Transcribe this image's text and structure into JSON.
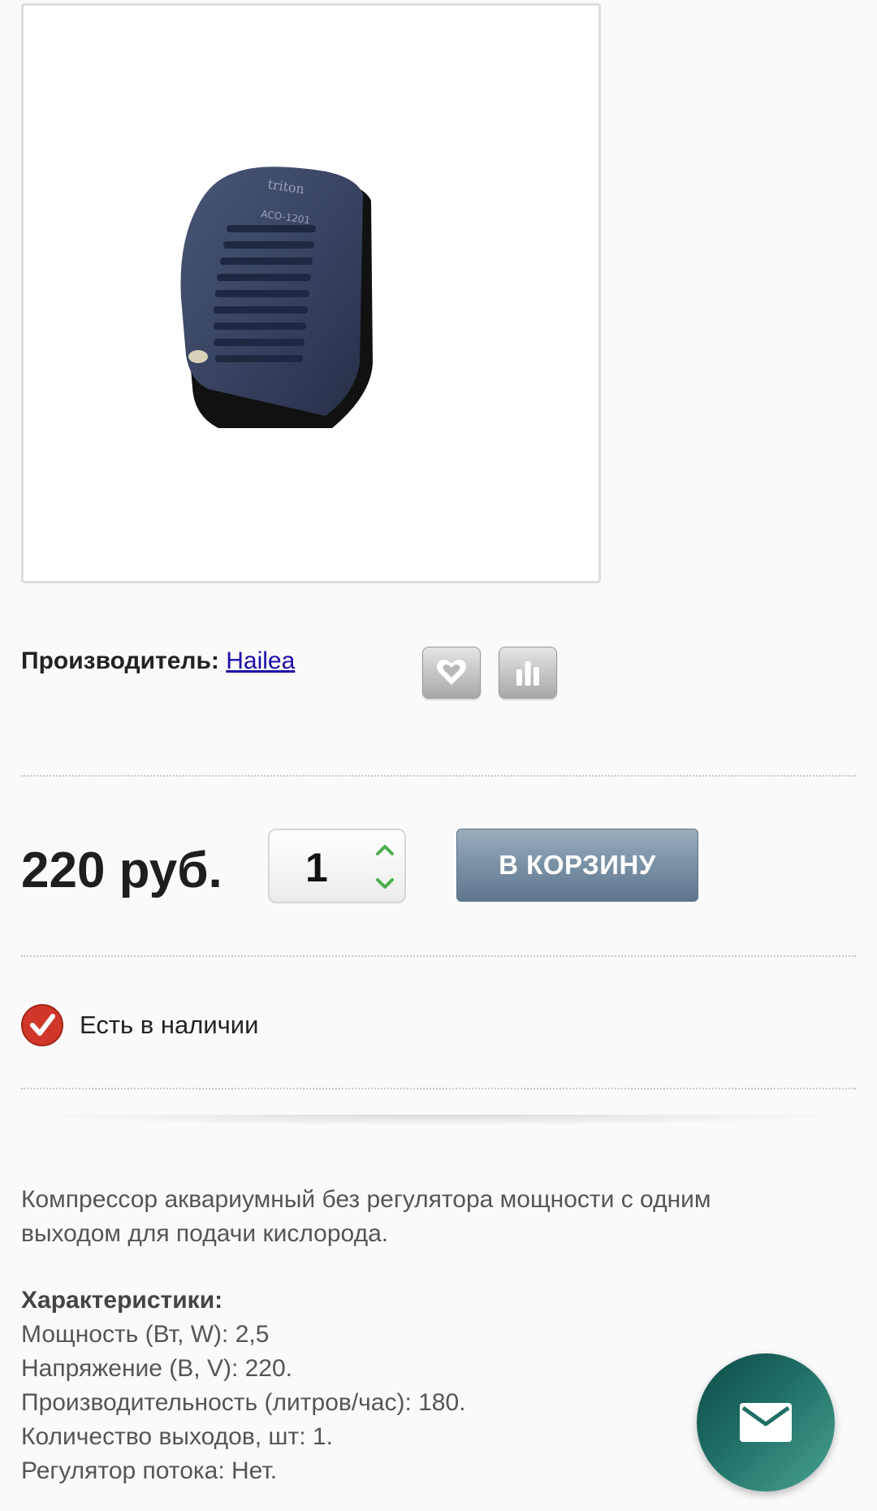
{
  "product_image": {
    "device_brand": "triton",
    "device_model": "ACO-1201"
  },
  "manufacturer": {
    "label": "Производитель:",
    "name": "Hailea"
  },
  "actions": {
    "wishlist_icon": "heart-icon",
    "compare_icon": "bar-chart-icon"
  },
  "purchase": {
    "price": "220 руб.",
    "quantity": "1",
    "add_to_cart_label": "В КОРЗИНУ"
  },
  "availability": {
    "text": "Есть в наличии",
    "icon": "check-badge-icon"
  },
  "description": {
    "line1": "Компрессор аквариумный без регулятора мощности с одним",
    "line2": "выходом для подачи кислорода."
  },
  "specs": {
    "heading": "Характеристики:",
    "items": [
      "Мощность (Вт, W): 2,5",
      "Напряжение (В, V): 220.",
      "Производительность (литров/час): 180.",
      "Количество выходов, шт: 1.",
      "Регулятор потока: Нет."
    ]
  },
  "fab": {
    "icon": "envelope-icon"
  },
  "colors": {
    "cart_button": "#7c93a7",
    "check_badge": "#d0372a",
    "fab": "#1f6f66",
    "link": "#1a0dab"
  }
}
